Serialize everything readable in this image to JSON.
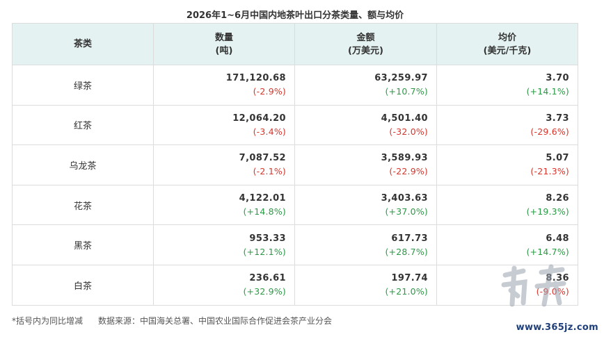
{
  "title": "2026年1~6月中国内地茶叶出口分茶类量、额与均价",
  "headers": {
    "category": "茶类",
    "quantity": "数量",
    "quantity_unit": "(吨)",
    "amount": "金额",
    "amount_unit": "(万美元)",
    "price": "均价",
    "price_unit": "(美元/千克)"
  },
  "rows": [
    {
      "category": "绿茶",
      "quantity": "171,120.68",
      "quantity_chg": "(-2.9%)",
      "amount": "63,259.97",
      "amount_chg": "(+10.7%)",
      "price": "3.70",
      "price_chg": "(+14.1%)"
    },
    {
      "category": "红茶",
      "quantity": "12,064.20",
      "quantity_chg": "(-3.4%)",
      "amount": "4,501.40",
      "amount_chg": "(-32.0%)",
      "price": "3.73",
      "price_chg": "(-29.6%)"
    },
    {
      "category": "乌龙茶",
      "quantity": "7,087.52",
      "quantity_chg": "(-2.1%)",
      "amount": "3,589.93",
      "amount_chg": "(-22.9%)",
      "price": "5.07",
      "price_chg": "(-21.3%)"
    },
    {
      "category": "花茶",
      "quantity": "4,122.01",
      "quantity_chg": "(+14.8%)",
      "amount": "3,403.63",
      "amount_chg": "(+37.0%)",
      "price": "8.26",
      "price_chg": "(+19.3%)"
    },
    {
      "category": "黑茶",
      "quantity": "953.33",
      "quantity_chg": "(+12.1%)",
      "amount": "617.73",
      "amount_chg": "(+28.7%)",
      "price": "6.48",
      "price_chg": "(+14.7%)"
    },
    {
      "category": "白茶",
      "quantity": "236.61",
      "quantity_chg": "(+32.9%)",
      "amount": "197.74",
      "amount_chg": "(+21.0%)",
      "price": "8.36",
      "price_chg": "(-9.0%)"
    }
  ],
  "footnote": {
    "note": "*括号内为同比增减",
    "source": "数据来源：中国海关总署、中国农业国际合作促进会茶产业分会"
  },
  "watermark": {
    "logo_text": "南方",
    "site": "www.365jz.com"
  },
  "colors": {
    "header_bg": "#e4f2f1",
    "negative": "#d9342b",
    "positive": "#2a9a45",
    "border": "#dcdcdc"
  }
}
